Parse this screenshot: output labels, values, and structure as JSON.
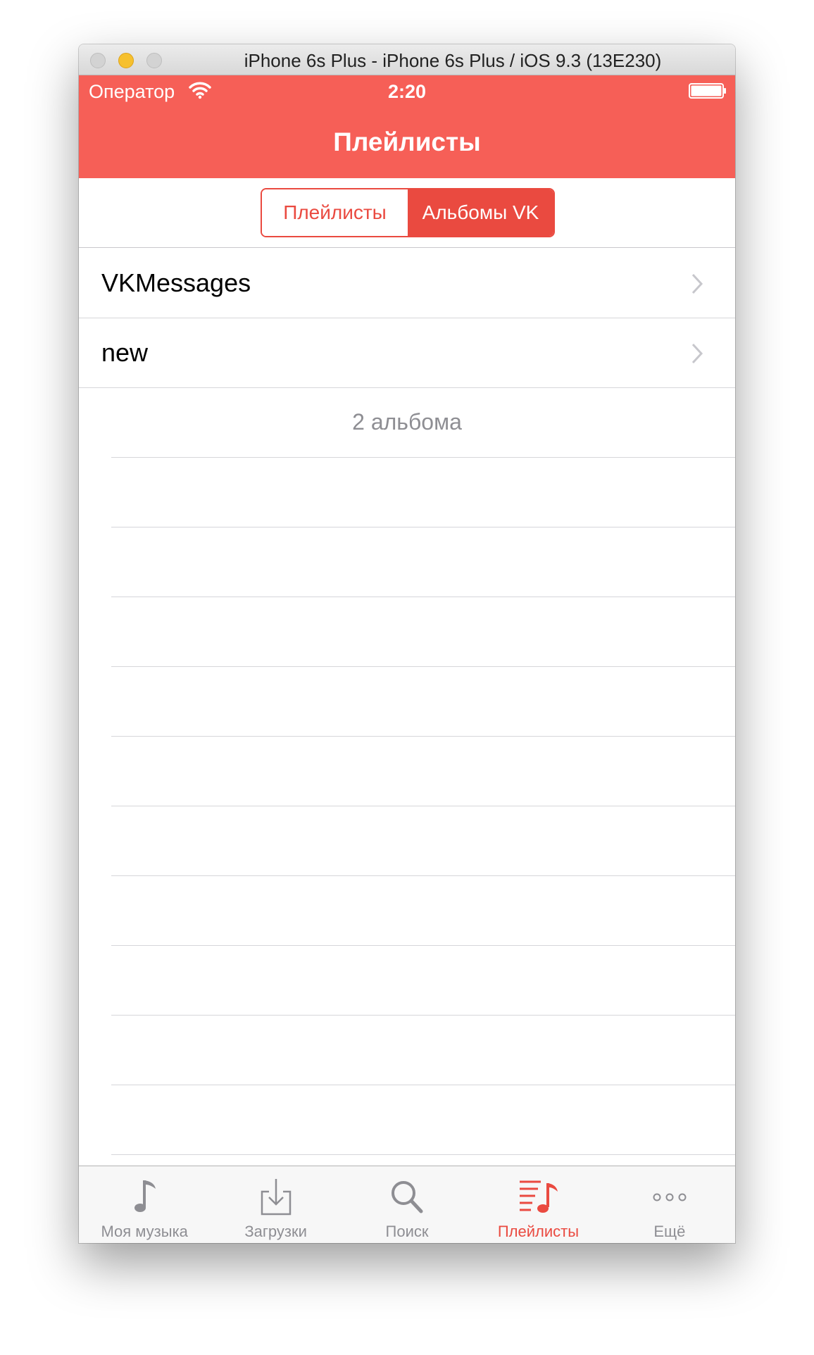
{
  "window": {
    "title": "iPhone 6s Plus - iPhone 6s Plus / iOS 9.3 (13E230)"
  },
  "status_bar": {
    "carrier": "Оператор",
    "time": "2:20"
  },
  "nav": {
    "title": "Плейлисты"
  },
  "segmented": {
    "items": [
      {
        "label": "Плейлисты",
        "selected": false
      },
      {
        "label": "Альбомы VK",
        "selected": true
      }
    ]
  },
  "list": {
    "rows": [
      {
        "label": "VKMessages"
      },
      {
        "label": "new"
      }
    ],
    "footer": "2  альбома"
  },
  "tabbar": {
    "items": [
      {
        "label": "Моя музыка",
        "icon": "music-note-icon"
      },
      {
        "label": "Загрузки",
        "icon": "download-icon"
      },
      {
        "label": "Поиск",
        "icon": "search-icon"
      },
      {
        "label": "Плейлисты",
        "icon": "playlist-icon",
        "active": true
      },
      {
        "label": "Ещё",
        "icon": "more-icon"
      }
    ]
  },
  "colors": {
    "accent": "#ea4a40",
    "navbar": "#f65f57",
    "inactive": "#8e8e93"
  }
}
